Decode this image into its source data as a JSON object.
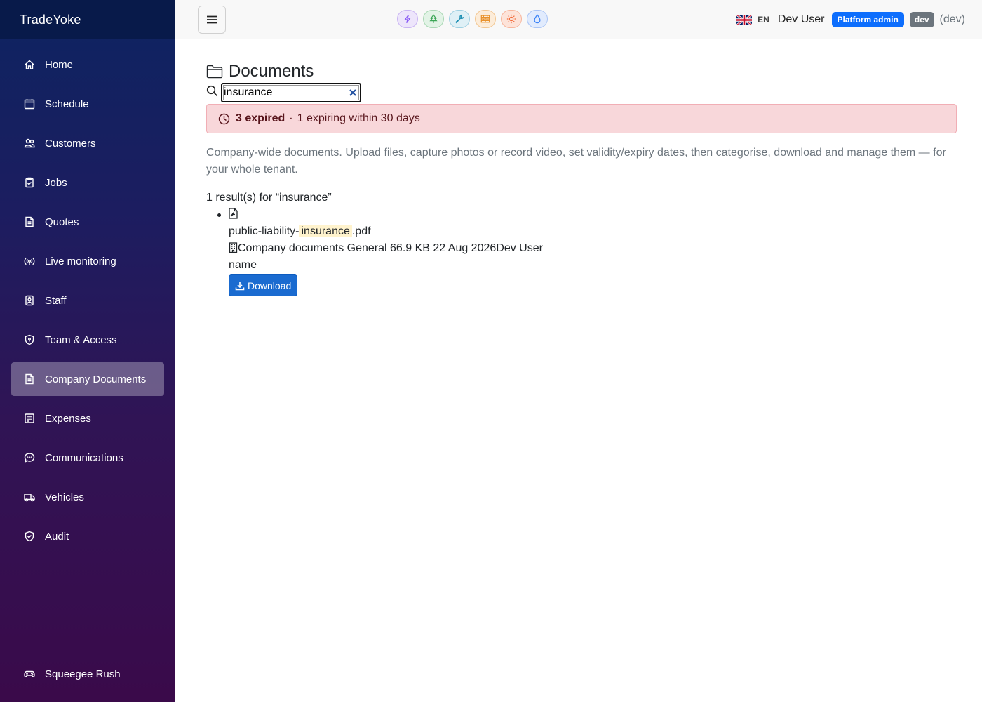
{
  "app": {
    "brand": "TradeYoke"
  },
  "sidebar": {
    "items": [
      {
        "label": "Home",
        "icon": "home-icon"
      },
      {
        "label": "Schedule",
        "icon": "calendar-icon"
      },
      {
        "label": "Customers",
        "icon": "people-icon"
      },
      {
        "label": "Jobs",
        "icon": "clipboard-icon"
      },
      {
        "label": "Quotes",
        "icon": "document-icon"
      },
      {
        "label": "Live monitoring",
        "icon": "broadcast-icon"
      },
      {
        "label": "Staff",
        "icon": "person-badge-icon"
      },
      {
        "label": "Team & Access",
        "icon": "shield-icon"
      },
      {
        "label": "Company Documents",
        "icon": "document-icon",
        "active": true
      },
      {
        "label": "Expenses",
        "icon": "receipt-icon"
      },
      {
        "label": "Communications",
        "icon": "chat-icon"
      },
      {
        "label": "Vehicles",
        "icon": "truck-icon"
      },
      {
        "label": "Audit",
        "icon": "shield-check-icon"
      }
    ],
    "bottom": {
      "label": "Squeegee Rush",
      "icon": "gamepad-icon"
    }
  },
  "header": {
    "trade_icons": [
      {
        "name": "lightning-icon",
        "color": "#8b5cf6"
      },
      {
        "name": "tree-icon",
        "color": "#3aa655"
      },
      {
        "name": "wrench-icon",
        "color": "#1f8fb3"
      },
      {
        "name": "bricks-icon",
        "color": "#e8912b"
      },
      {
        "name": "sun-icon",
        "color": "#f26b3a"
      },
      {
        "name": "droplet-icon",
        "color": "#3b82f6"
      }
    ],
    "lang": "EN",
    "user": "Dev User",
    "role_badge": "Platform admin",
    "env_badge": "dev",
    "env_text": "(dev)"
  },
  "page": {
    "title": "Documents",
    "search": {
      "value": "insurance"
    },
    "alert": {
      "expired": "3 expired",
      "separator": "·",
      "expiring": "1 expiring within 30 days"
    },
    "description": "Company-wide documents. Upload files, capture photos or record video, set validity/expiry dates, then categorise, download and manage them — for your whole tenant.",
    "results_summary": "1 result(s) for “insurance”",
    "documents": [
      {
        "name_prefix": "public-liability-",
        "name_highlight": "insurance",
        "name_suffix": ".pdf",
        "scope": "Company documents",
        "category": "General",
        "size": "66.9 KB",
        "expiry": "22 Aug 2026",
        "uploader": "Dev User",
        "extra": "name",
        "download_label": "Download"
      }
    ]
  },
  "colors": {
    "accent": "#1a6bd0",
    "alert_bg": "#f8d7da",
    "sidebar_top": "#0d2461",
    "sidebar_bottom": "#3a0a4a"
  }
}
